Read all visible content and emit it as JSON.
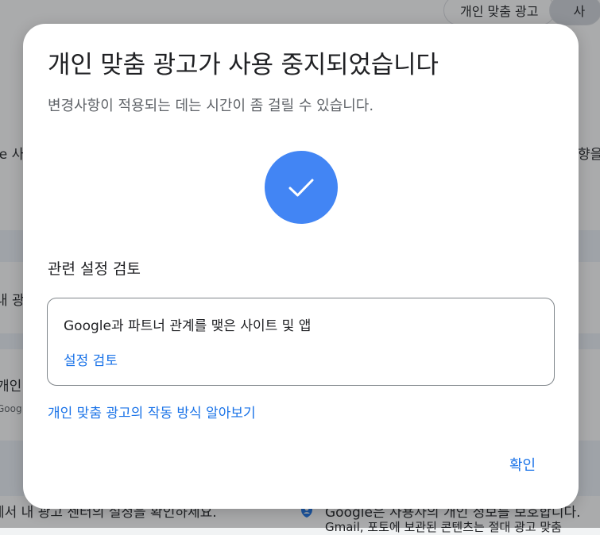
{
  "background": {
    "chips": [
      "개인 맞춤 광고",
      "사"
    ],
    "fragments": {
      "left_1": "le 사",
      "right_1": "향을",
      "left_2": "내 광",
      "left_3": "개인",
      "left_3_small": "Goog",
      "bottom_left": "세서 내 광고 센터의 설정을 확인하세요.",
      "bottom_right_1": "Google은 사용자의 개인 정보를 보호합니다.",
      "bottom_right_2": "Gmail, 포토에 보관된 콘텐츠는 절대 광고 맞춤"
    }
  },
  "dialog": {
    "title": "개인 맞춤 광고가 사용 중지되었습니다",
    "subtitle": "변경사항이 적용되는 데는 시간이 좀 걸릴 수 있습니다.",
    "section_heading": "관련 설정 검토",
    "card": {
      "text": "Google과 파트너 관계를 맺은 사이트 및 앱",
      "link": "설정 검토"
    },
    "learn_link": "개인 맞춤 광고의 작동 방식 알아보기",
    "confirm_button": "확인"
  },
  "colors": {
    "accent": "#1a73e8",
    "check_circle": "#4285f4"
  },
  "icons": {
    "success": "check-icon",
    "privacy": "shield-icon"
  }
}
